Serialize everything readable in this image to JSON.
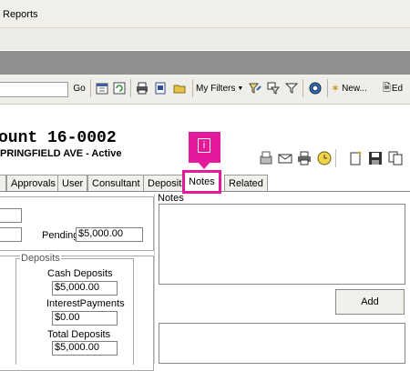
{
  "menu": {
    "reports": "Reports"
  },
  "toolbar": {
    "go_label": "Go",
    "my_filters_label": "My Filters",
    "new_label": "New...",
    "ed_label": "Ed"
  },
  "record": {
    "title": "ount 16-0002",
    "subtitle": "PRINGFIELD AVE - Active"
  },
  "tabs": [
    {
      "label": "Approvals"
    },
    {
      "label": "User"
    },
    {
      "label": "Consultant"
    },
    {
      "label": "Deposits"
    },
    {
      "label": "Notes"
    },
    {
      "label": "Related"
    }
  ],
  "marker": {
    "label": "i"
  },
  "summary": {
    "pending_label": "Pending",
    "pending_value": "$5,000.00"
  },
  "deposits": {
    "group_label": "Deposits",
    "cash_label": "Cash Deposits",
    "cash_value": "$5,000.00",
    "interest_label": "InterestPayments",
    "interest_value": "$0.00",
    "total_label": "Total Deposits",
    "total_value": "$5,000.00"
  },
  "notes": {
    "label": "Notes",
    "add_label": "Add"
  },
  "colors": {
    "highlight": "#e4199b",
    "banner_dark": "#8f8f8f"
  }
}
